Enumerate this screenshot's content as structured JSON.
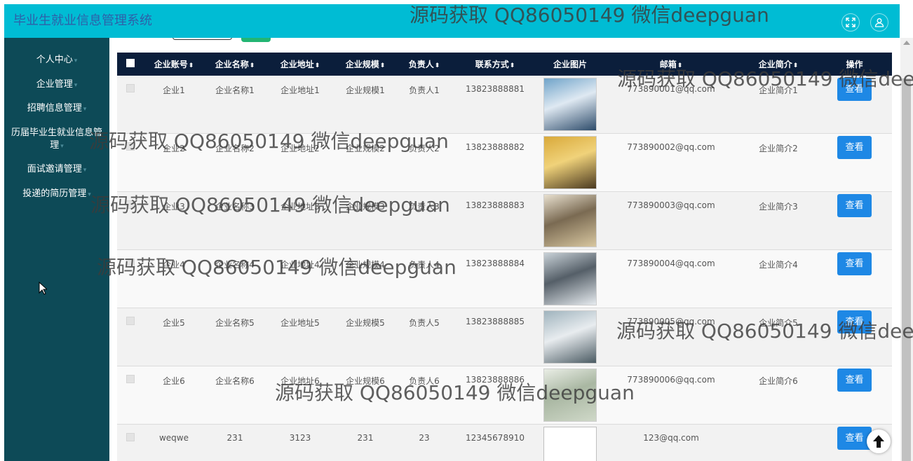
{
  "app_title": "毕业生就业信息管理系统",
  "header_icons": [
    "fullscreen-icon",
    "user-icon"
  ],
  "colors": {
    "header": "#00bcd4",
    "sidebar": "#0d4a57",
    "table_head": "#0b1e3b",
    "view_button": "#1e88e5"
  },
  "sidebar": {
    "items": [
      {
        "label": "个人中心"
      },
      {
        "label": "企业管理"
      },
      {
        "label": "招聘信息管理"
      },
      {
        "label": "历届毕业生就业信息管理"
      },
      {
        "label": "面试邀请管理"
      },
      {
        "label": "投递的简历管理"
      }
    ]
  },
  "table": {
    "columns": [
      "企业账号",
      "企业名称",
      "企业地址",
      "企业规模",
      "负责人",
      "联系方式",
      "企业图片",
      "邮箱",
      "企业简介",
      "操作"
    ],
    "view_label": "查看",
    "rows": [
      {
        "account": "企业1",
        "name": "企业名称1",
        "address": "企业地址1",
        "scale": "企业规模1",
        "contact": "负责人1",
        "phone": "13823888881",
        "email": "773890001@qq.com",
        "intro": "企业简介1",
        "image": "office-photo-1"
      },
      {
        "account": "企业2",
        "name": "企业名称2",
        "address": "企业地址2",
        "scale": "企业规模2",
        "contact": "负责人2",
        "phone": "13823888882",
        "email": "773890002@qq.com",
        "intro": "企业简介2",
        "image": "office-photo-2"
      },
      {
        "account": "企业3",
        "name": "企业名称3",
        "address": "企业地址3",
        "scale": "企业规模3",
        "contact": "负责人3",
        "phone": "13823888883",
        "email": "773890003@qq.com",
        "intro": "企业简介3",
        "image": "office-photo-3"
      },
      {
        "account": "企业4",
        "name": "企业名称4",
        "address": "企业地址4",
        "scale": "企业规模4",
        "contact": "负责人4",
        "phone": "13823888884",
        "email": "773890004@qq.com",
        "intro": "企业简介4",
        "image": "office-photo-4"
      },
      {
        "account": "企业5",
        "name": "企业名称5",
        "address": "企业地址5",
        "scale": "企业规模5",
        "contact": "负责人5",
        "phone": "13823888885",
        "email": "773890005@qq.com",
        "intro": "企业简介5",
        "image": "office-photo-5"
      },
      {
        "account": "企业6",
        "name": "企业名称6",
        "address": "企业地址6",
        "scale": "企业规模6",
        "contact": "负责人6",
        "phone": "13823888886",
        "email": "773890006@qq.com",
        "intro": "企业简介6",
        "image": "office-photo-6"
      },
      {
        "account": "weqwe",
        "name": "231",
        "address": "3123",
        "scale": "231",
        "contact": "23",
        "phone": "12345678910",
        "email": "123@qq.com",
        "intro": "",
        "image": "broken-image"
      }
    ]
  },
  "watermark": "源码获取 QQ86050149 微信deepguan"
}
